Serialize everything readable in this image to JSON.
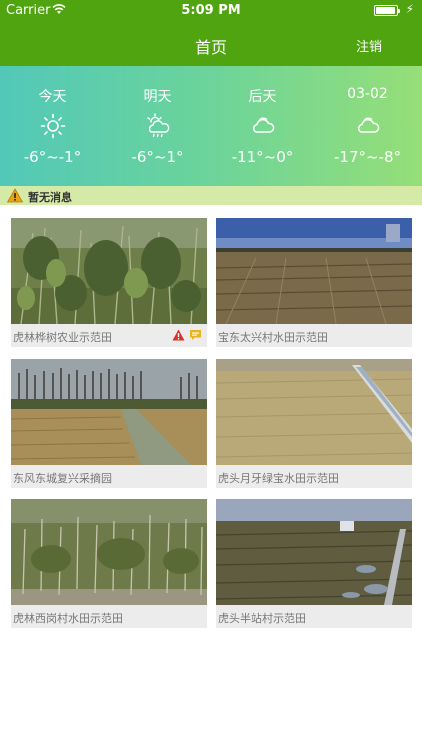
{
  "status_bar": {
    "carrier": "Carrier",
    "time": "5:09 PM",
    "battery_level": 0.9
  },
  "nav": {
    "title": "首页",
    "logout_label": "注销",
    "bar_color": "#4fa410"
  },
  "weather": {
    "days": [
      {
        "label": "今天",
        "icon": "sun-icon",
        "temp": "-6°~-1°"
      },
      {
        "label": "明天",
        "icon": "sun-cloud-rain-icon",
        "temp": "-6°~1°"
      },
      {
        "label": "后天",
        "icon": "cloud-icon",
        "temp": "-11°~0°"
      },
      {
        "label": "03-02",
        "icon": "cloud-icon",
        "temp": "-17°~-8°"
      }
    ]
  },
  "notice": {
    "icon": "warning-icon",
    "text": "暂无消息"
  },
  "sites": [
    {
      "name": "虎林桦树农业示范田",
      "has_warning": true,
      "has_message": true
    },
    {
      "name": "宝东太兴村水田示范田"
    },
    {
      "name": "东风东城复兴采摘园"
    },
    {
      "name": "虎头月牙绿宝水田示范田"
    },
    {
      "name": "虎林西岗村水田示范田"
    },
    {
      "name": "虎头半站村示范田"
    }
  ]
}
